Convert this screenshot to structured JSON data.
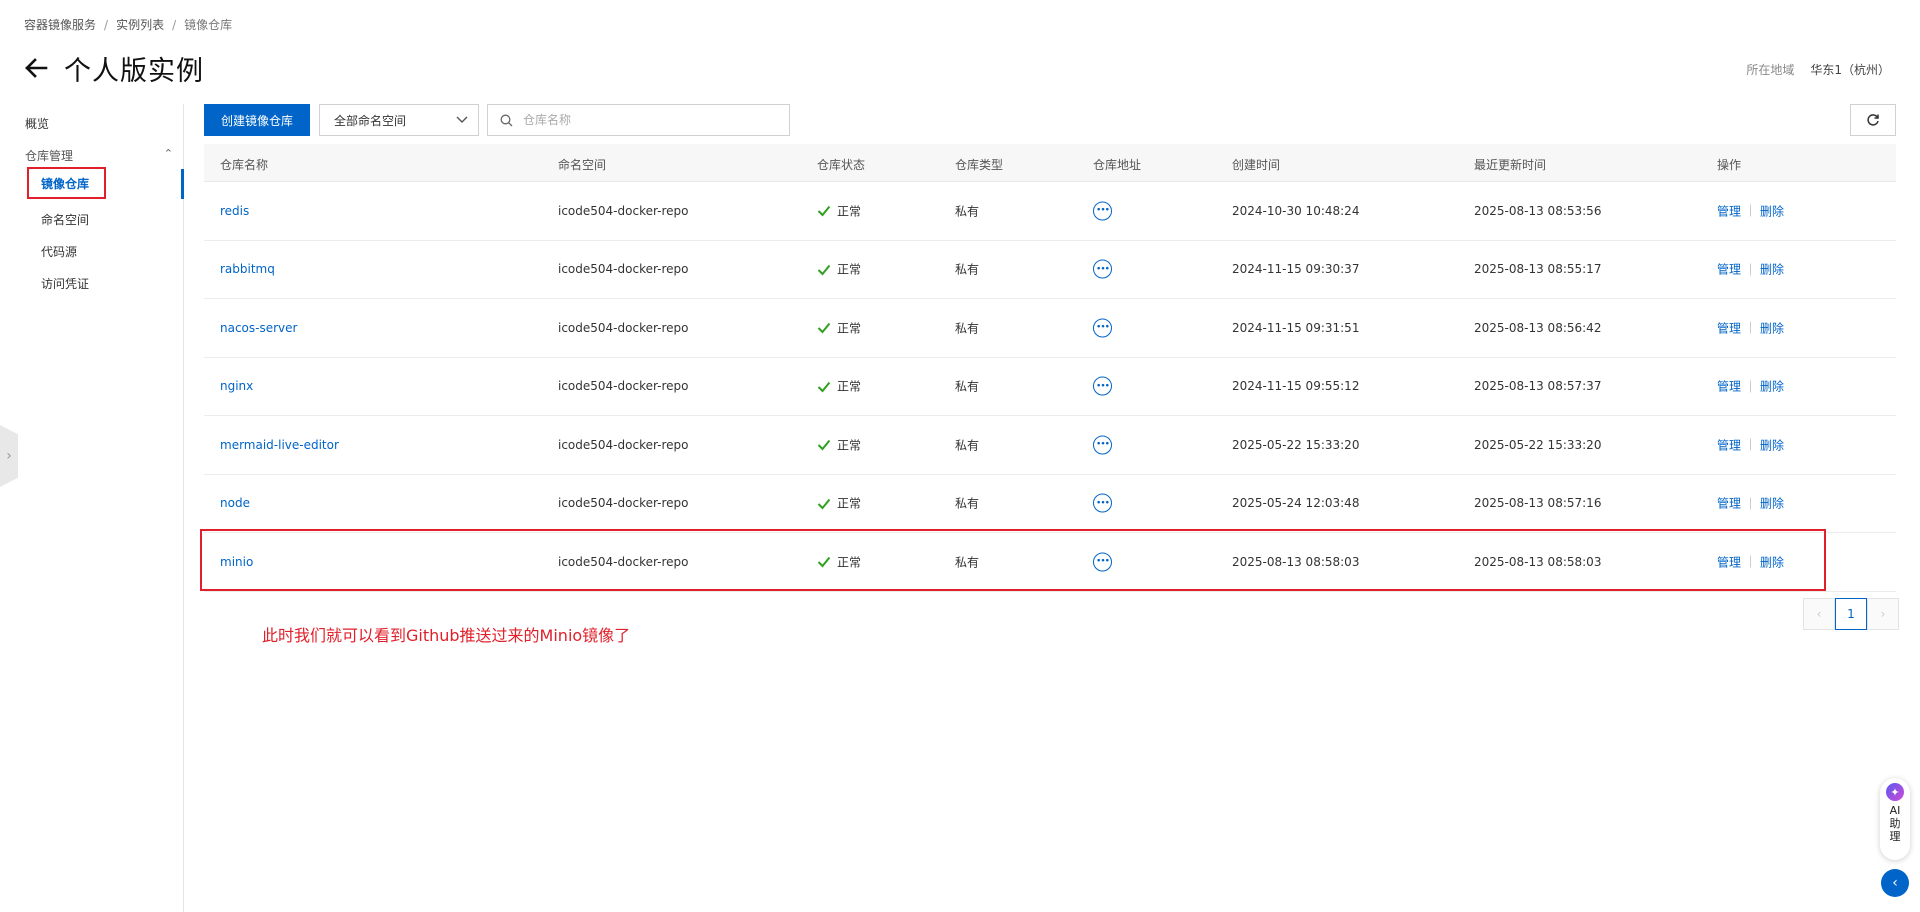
{
  "breadcrumb": [
    "容器镜像服务",
    "实例列表",
    "镜像仓库"
  ],
  "page_title": "个人版实例",
  "region": {
    "label": "所在地域",
    "value": "华东1（杭州）"
  },
  "sidebar": {
    "overview": "概览",
    "group": "仓库管理",
    "items": [
      "镜像仓库",
      "命名空间",
      "代码源",
      "访问凭证"
    ]
  },
  "toolbar": {
    "create_label": "创建镜像仓库",
    "namespace_select": "全部命名空间",
    "search_placeholder": "仓库名称"
  },
  "table": {
    "headers": [
      "仓库名称",
      "命名空间",
      "仓库状态",
      "仓库类型",
      "仓库地址",
      "创建时间",
      "最近更新时间",
      "操作"
    ],
    "rows": [
      {
        "name": "redis",
        "namespace": "icode504-docker-repo",
        "status": "正常",
        "type": "私有",
        "created": "2024-10-30 10:48:24",
        "updated": "2025-08-13 08:53:56",
        "manage": "管理",
        "delete": "删除"
      },
      {
        "name": "rabbitmq",
        "namespace": "icode504-docker-repo",
        "status": "正常",
        "type": "私有",
        "created": "2024-11-15 09:30:37",
        "updated": "2025-08-13 08:55:17",
        "manage": "管理",
        "delete": "删除"
      },
      {
        "name": "nacos-server",
        "namespace": "icode504-docker-repo",
        "status": "正常",
        "type": "私有",
        "created": "2024-11-15 09:31:51",
        "updated": "2025-08-13 08:56:42",
        "manage": "管理",
        "delete": "删除"
      },
      {
        "name": "nginx",
        "namespace": "icode504-docker-repo",
        "status": "正常",
        "type": "私有",
        "created": "2024-11-15 09:55:12",
        "updated": "2025-08-13 08:57:37",
        "manage": "管理",
        "delete": "删除"
      },
      {
        "name": "mermaid-live-editor",
        "namespace": "icode504-docker-repo",
        "status": "正常",
        "type": "私有",
        "created": "2025-05-22 15:33:20",
        "updated": "2025-05-22 15:33:20",
        "manage": "管理",
        "delete": "删除"
      },
      {
        "name": "node",
        "namespace": "icode504-docker-repo",
        "status": "正常",
        "type": "私有",
        "created": "2025-05-24 12:03:48",
        "updated": "2025-08-13 08:57:16",
        "manage": "管理",
        "delete": "删除"
      },
      {
        "name": "minio",
        "namespace": "icode504-docker-repo",
        "status": "正常",
        "type": "私有",
        "created": "2025-08-13 08:58:03",
        "updated": "2025-08-13 08:58:03",
        "manage": "管理",
        "delete": "删除"
      }
    ]
  },
  "annotation_note": "此时我们就可以看到Github推送过来的Minio镜像了",
  "pagination": {
    "current": "1"
  },
  "ai_assistant": {
    "label": "AI助理"
  },
  "colors": {
    "primary": "#0064c8",
    "annotation_red": "#e0202a",
    "success_green": "#2ea121"
  }
}
